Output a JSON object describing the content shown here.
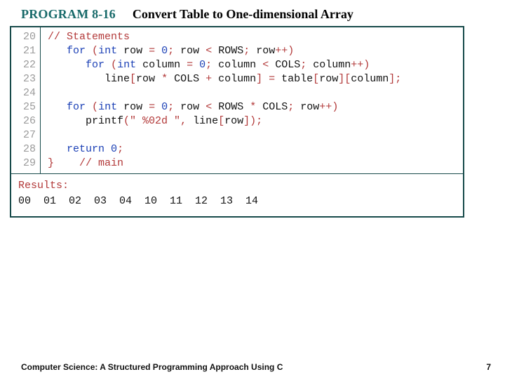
{
  "header": {
    "program_label": "PROGRAM 8-16",
    "title": "Convert Table to One-dimensional Array"
  },
  "code": {
    "line_numbers": [
      "20",
      "21",
      "22",
      "23",
      "24",
      "25",
      "26",
      "27",
      "28",
      "29"
    ],
    "tokens": {
      "c20": "// Statements",
      "kw_for": "for",
      "kw_int": "int",
      "kw_return": "return",
      "id_row": "row",
      "id_column": "column",
      "id_line": "line",
      "id_table": "table",
      "id_ROWS": "ROWS",
      "id_COLS": "COLS",
      "num0a": "0",
      "num0b": "0",
      "num0c": "0",
      "num0d": "0",
      "fn_printf": "printf",
      "str_fmt": "\" %02d \"",
      "cmt_main": "// main",
      "lp": "(",
      "rp": ")",
      "lb": "[",
      "rb": "]",
      "lcb": "}",
      "semi": ";",
      "comma": ",",
      "assign": " = ",
      "lt": " < ",
      "plusplus": "++",
      "star": " * ",
      "plus": " + ",
      "star2": " * ",
      "sp1": "   ",
      "sp2": "      ",
      "sp3": "         ",
      "sp_tab": "    "
    }
  },
  "results": {
    "label": "Results:",
    "values": "00  01  02  03  04  10  11  12  13  14"
  },
  "footer": {
    "book": "Computer Science: A Structured Programming Approach Using C",
    "page": "7"
  }
}
